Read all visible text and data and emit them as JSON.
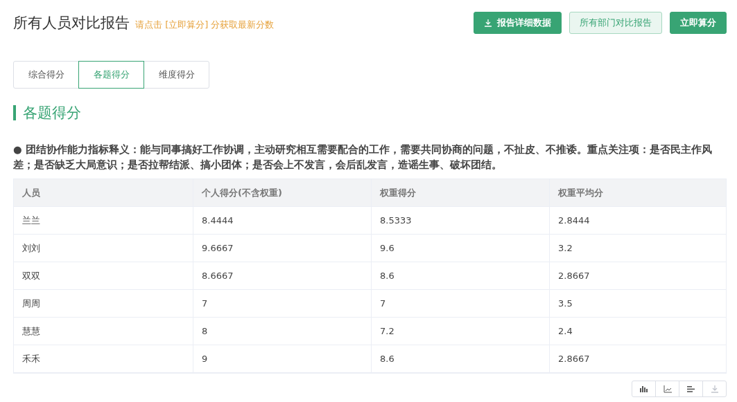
{
  "header": {
    "title": "所有人员对比报告",
    "hint": "请点击 [立即算分] 分获取最新分数"
  },
  "buttons": [
    {
      "label": "报告详细数据",
      "kind": "download"
    },
    {
      "label": "所有部门对比报告",
      "kind": "light"
    },
    {
      "label": "立即算分",
      "kind": "primary"
    }
  ],
  "tabs": [
    {
      "label": "综合得分",
      "selected": false
    },
    {
      "label": "各题得分",
      "selected": true
    },
    {
      "label": "维度得分",
      "selected": false
    }
  ],
  "section_title": "各题得分",
  "description": "● 团结协作能力指标释义：能与同事搞好工作协调，主动研究相互需要配合的工作，需要共同协商的问题，不扯皮、不推诿。重点关注项：是否民主作风差；是否缺乏大局意识；是否拉帮结派、搞小团体；是否会上不发言，会后乱发言，造谣生事、破坏团结。",
  "table": {
    "columns": [
      "人员",
      "个人得分(不含权重)",
      "权重得分",
      "权重平均分"
    ],
    "rows": [
      [
        "兰兰",
        "8.4444",
        "8.5333",
        "2.8444"
      ],
      [
        "刘刘",
        "9.6667",
        "9.6",
        "3.2"
      ],
      [
        "双双",
        "8.6667",
        "8.6",
        "2.8667"
      ],
      [
        "周周",
        "7",
        "7",
        "3.5"
      ],
      [
        "慧慧",
        "8",
        "7.2",
        "2.4"
      ],
      [
        "禾禾",
        "9",
        "8.6",
        "2.8667"
      ]
    ]
  },
  "chart_tools": [
    {
      "kind": "bar",
      "disabled": false
    },
    {
      "kind": "line",
      "disabled": false
    },
    {
      "kind": "table",
      "disabled": false
    },
    {
      "kind": "download",
      "disabled": true
    }
  ]
}
